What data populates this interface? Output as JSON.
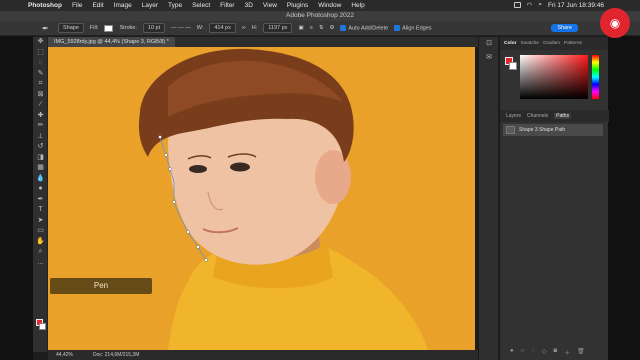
{
  "menubar": {
    "app_name": "Photoshop",
    "items": [
      "File",
      "Edit",
      "Image",
      "Layer",
      "Type",
      "Select",
      "Filter",
      "3D",
      "View",
      "Plugins",
      "Window",
      "Help"
    ],
    "clock": "Fri 17 Jun  18:39:46"
  },
  "window_title": "Adobe Photoshop 2022",
  "options": {
    "mode": "Shape",
    "fill_label": "Fill:",
    "stroke_label": "Stroke:",
    "stroke_size": "10 pt",
    "width_label": "W:",
    "width_value": "414 px",
    "height_label": "H:",
    "height_value": "1197 px",
    "auto_add_delete": "Auto Add/Delete",
    "align_edges": "Align Edges",
    "share": "Share"
  },
  "document_tab": "IMG_5928rdy.jpg @ 44,4% (Shape 3, RGB/8) *",
  "status": {
    "zoom": "44,42%",
    "doc": "Doc: 214,6M/215,3M"
  },
  "caption": "Pen",
  "color_panel": {
    "tabs": [
      "Color",
      "Swatche",
      "Gradien",
      "Patterns"
    ],
    "active_tab": "Color",
    "foreground": "#e3262c",
    "background": "#ffffff"
  },
  "layers_panel": {
    "tabs": [
      "Layers",
      "Channels",
      "Paths"
    ],
    "active_tab": "Paths",
    "paths": [
      {
        "name": "Shape 3 Shape Path"
      }
    ]
  },
  "colors": {
    "canvas_bg": "#e8a020",
    "accent": "#1473e6",
    "record_button": "#e0252f"
  }
}
